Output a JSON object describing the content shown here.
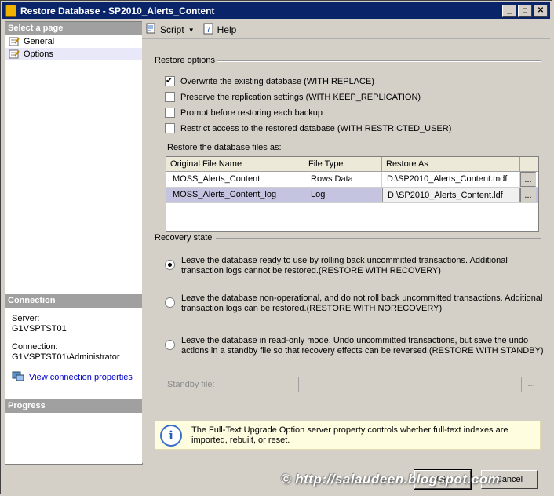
{
  "window": {
    "title": "Restore Database - SP2010_Alerts_Content"
  },
  "left_pane": {
    "select_page_header": "Select a page",
    "pages": [
      {
        "label": "General"
      },
      {
        "label": "Options"
      }
    ],
    "connection_header": "Connection",
    "server_label": "Server:",
    "server_value": "G1VSPTST01",
    "connection_label": "Connection:",
    "connection_value": "G1VSPTST01\\Administrator",
    "view_props_link": "View connection properties",
    "progress_header": "Progress"
  },
  "toolbar": {
    "script_label": "Script",
    "help_label": "Help"
  },
  "restore_options": {
    "title": "Restore options",
    "checkboxes": [
      {
        "label": "Overwrite the existing database (WITH REPLACE)",
        "checked": true
      },
      {
        "label": "Preserve the replication settings (WITH KEEP_REPLICATION)",
        "checked": false
      },
      {
        "label": "Prompt before restoring each backup",
        "checked": false
      },
      {
        "label": "Restrict access to the restored database (WITH RESTRICTED_USER)",
        "checked": false
      }
    ],
    "files_label": "Restore the database files as:"
  },
  "files_grid": {
    "columns": [
      "Original File Name",
      "File Type",
      "Restore As"
    ],
    "rows": [
      {
        "original": "MOSS_Alerts_Content",
        "type": "Rows Data",
        "restore_as": "D:\\SP2010_Alerts_Content.mdf",
        "button": "..."
      },
      {
        "original": "MOSS_Alerts_Content_log",
        "type": "Log",
        "restore_as": "D:\\SP2010_Alerts_Content.ldf",
        "button": "..."
      }
    ]
  },
  "recovery": {
    "title": "Recovery state",
    "options": [
      {
        "line1": "Leave the database ready to use by rolling back uncommitted transactions. Additional",
        "line2": "transaction logs cannot be restored.(RESTORE WITH RECOVERY)",
        "selected": true
      },
      {
        "line1": "Leave the database non-operational, and do not roll back uncommitted transactions. Additional",
        "line2": "transaction logs can be restored.(RESTORE WITH NORECOVERY)",
        "selected": false
      },
      {
        "line1": "Leave the database in read-only mode. Undo uncommitted transactions, but save the undo",
        "line2": "actions in a standby file so that recovery effects can be reversed.(RESTORE WITH STANDBY)",
        "selected": false
      }
    ],
    "standby_label": "Standby file:",
    "standby_button": "..."
  },
  "info": {
    "text": "The Full-Text Upgrade Option server property controls whether full-text indexes are imported, rebuilt, or reset."
  },
  "buttons": {
    "ok": "OK",
    "cancel": "Cancel"
  },
  "watermark": "© http://salaudeen.blogspot.com"
}
